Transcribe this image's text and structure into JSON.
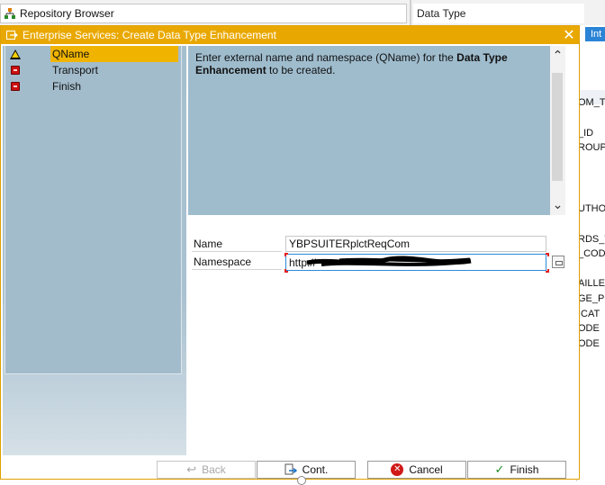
{
  "background": {
    "repository_browser_label": "Repository Browser",
    "data_type_label": "Data Type",
    "int_button_label": "Int",
    "right_fields": [
      "OM_T",
      "_ID",
      "ROUP_",
      "UTHO",
      "RDS_T",
      "_CODI",
      "AILLE_",
      "GE_P",
      "ICAT",
      "ODE",
      "ODE"
    ]
  },
  "dialog": {
    "title": "Enterprise Services: Create Data Type Enhancement",
    "close_symbol": "✕",
    "steps": [
      {
        "label": "QName",
        "icon": "warning-icon",
        "active": true
      },
      {
        "label": "Transport",
        "icon": "stop-icon",
        "active": false
      },
      {
        "label": "Finish",
        "icon": "stop-icon",
        "active": false
      }
    ],
    "info": {
      "text_before": "Enter external name and namespace (QName) for the ",
      "text_bold": "Data Type Enhancement",
      "text_after": " to be created."
    },
    "form": {
      "name_label": "Name",
      "name_value": "YBPSUITERplctReqCom",
      "namespace_label": "Namespace",
      "namespace_value": "http://"
    },
    "buttons": {
      "back": "Back",
      "cont": "Cont.",
      "cancel": "Cancel",
      "finish": "Finish"
    }
  },
  "colors": {
    "title_bar": "#e9a801",
    "panel_blue": "#9fbccd",
    "active_step": "#f0b400",
    "input_focus": "#2e8ad8"
  }
}
